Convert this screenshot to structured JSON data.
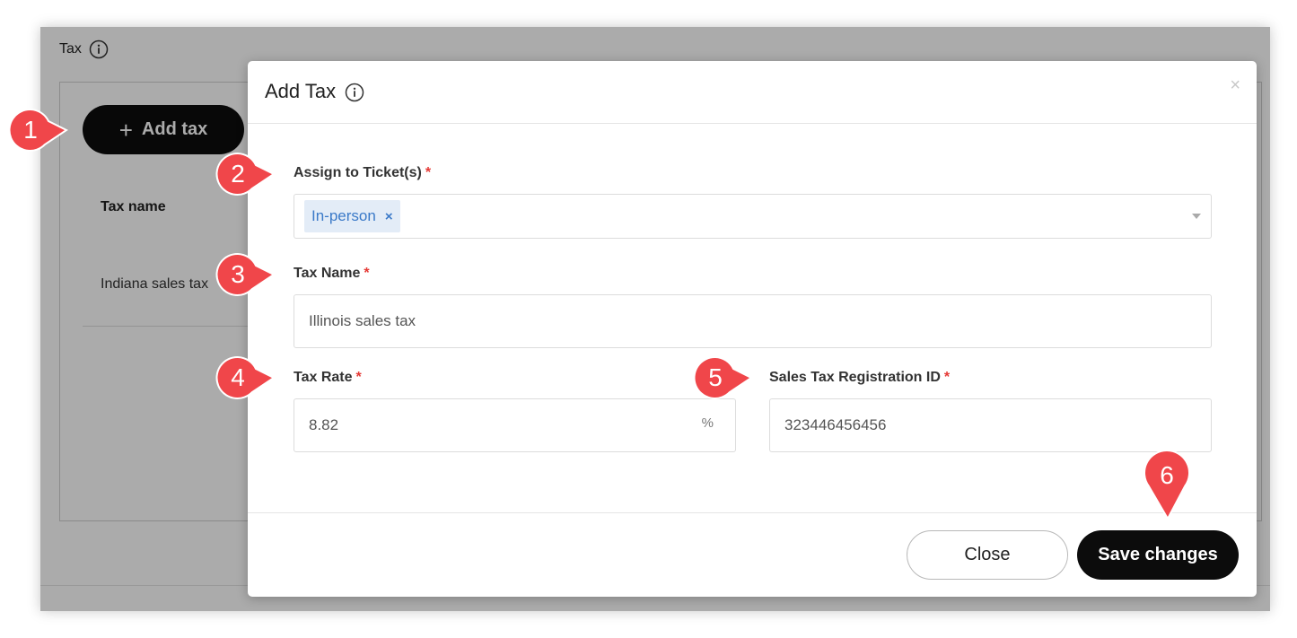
{
  "page": {
    "section_title": "Tax",
    "add_tax_label": "Add tax",
    "table": {
      "header_name": "Tax name",
      "rows": [
        {
          "name": "Indiana sales tax"
        }
      ]
    }
  },
  "modal": {
    "title": "Add Tax",
    "close_x": "×",
    "fields": {
      "tickets": {
        "label": "Assign to Ticket(s)",
        "required": "*",
        "selected": [
          "In-person"
        ],
        "chip_remove": "×"
      },
      "tax_name": {
        "label": "Tax Name",
        "required": "*",
        "value": "Illinois sales tax"
      },
      "tax_rate": {
        "label": "Tax Rate",
        "required": "*",
        "value": "8.82",
        "unit": "%"
      },
      "registration_id": {
        "label": "Sales Tax Registration ID",
        "required": "*",
        "value": "323446456456"
      }
    },
    "buttons": {
      "close": "Close",
      "save": "Save changes"
    }
  },
  "callouts": [
    "1",
    "2",
    "3",
    "4",
    "5",
    "6"
  ],
  "colors": {
    "callout": "#f0464a",
    "required": "#e53935",
    "primary_button": "#0c0c0c",
    "chip_bg": "#e3ecf7",
    "chip_text": "#3a79c8"
  },
  "icons": {
    "info": "info-icon",
    "plus": "plus-icon",
    "dropdown": "chevron-down-icon",
    "close": "close-icon"
  }
}
